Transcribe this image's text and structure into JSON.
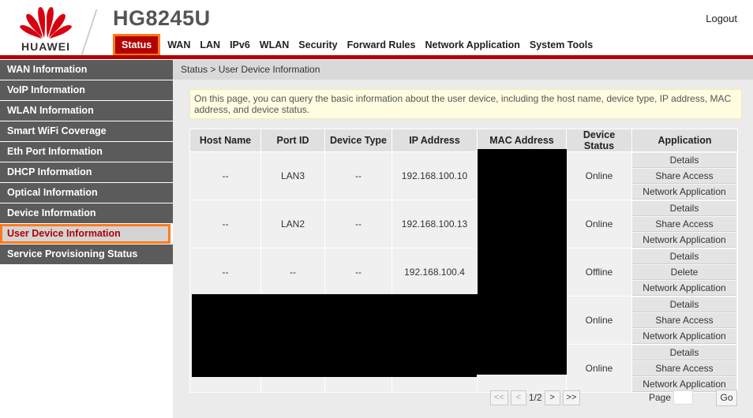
{
  "header": {
    "brand": "HUAWEI",
    "model": "HG8245U",
    "logout_label": "Logout"
  },
  "topnav": [
    {
      "label": "Status",
      "active": true
    },
    {
      "label": "WAN"
    },
    {
      "label": "LAN"
    },
    {
      "label": "IPv6"
    },
    {
      "label": "WLAN"
    },
    {
      "label": "Security"
    },
    {
      "label": "Forward Rules"
    },
    {
      "label": "Network Application"
    },
    {
      "label": "System Tools"
    }
  ],
  "sidebar": {
    "items": [
      {
        "label": "WAN Information"
      },
      {
        "label": "VoIP Information"
      },
      {
        "label": "WLAN Information"
      },
      {
        "label": "Smart WiFi Coverage"
      },
      {
        "label": "Eth Port Information"
      },
      {
        "label": "DHCP Information"
      },
      {
        "label": "Optical Information"
      },
      {
        "label": "Device Information"
      },
      {
        "label": "User Device Information",
        "active": true
      },
      {
        "label": "Service Provisioning Status"
      }
    ]
  },
  "main": {
    "breadcrumb": "Status > User Device Information",
    "description": "On this page, you can query the basic information about the user device, including the host name, device type, IP address, MAC address, and device status."
  },
  "table": {
    "headers": [
      "Host Name",
      "Port ID",
      "Device Type",
      "IP Address",
      "MAC Address",
      "Device Status",
      "Application"
    ],
    "rows": [
      {
        "host": "--",
        "port": "LAN3",
        "type": "--",
        "ip": "192.168.100.10",
        "mac": "",
        "status": "Online",
        "actions": [
          "Details",
          "Share Access",
          "Network Application"
        ]
      },
      {
        "host": "--",
        "port": "LAN2",
        "type": "--",
        "ip": "192.168.100.13",
        "mac": "",
        "status": "Online",
        "actions": [
          "Details",
          "Share Access",
          "Network Application"
        ]
      },
      {
        "host": "--",
        "port": "--",
        "type": "--",
        "ip": "192.168.100.4",
        "mac": "",
        "status": "Offline",
        "actions": [
          "Details",
          "Delete",
          "Network Application"
        ]
      },
      {
        "host": "",
        "port": "",
        "type": "",
        "ip": "",
        "mac": "",
        "status": "Online",
        "actions": [
          "Details",
          "Share Access",
          "Network Application"
        ]
      },
      {
        "host": "",
        "port": "",
        "type": "",
        "ip": "",
        "mac": "",
        "status": "Online",
        "actions": [
          "Details",
          "Share Access",
          "Network Application"
        ]
      }
    ]
  },
  "pager": {
    "first": "<<",
    "prev": "<",
    "page_indicator": "1/2",
    "next": ">",
    "last": ">>",
    "page_label": "Page",
    "go_label": "Go"
  },
  "colors": {
    "brand_red": "#b30000",
    "highlight_orange": "#ff7a1a",
    "sidebar_gray": "#5b5b5b"
  }
}
